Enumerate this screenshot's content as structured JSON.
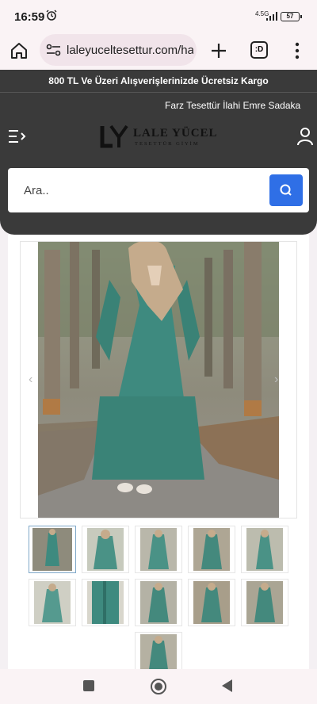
{
  "status": {
    "time": "16:59",
    "network": "4.5G",
    "battery": "57"
  },
  "browser": {
    "url": "laleyuceltesettur.com/haf",
    "tabs_label": ":D"
  },
  "promo": {
    "text": "800 TL Ve Üzeri Alışverişlerinizde Ücretsiz Kargo"
  },
  "ticker": {
    "text": "Farz Tesettür İlahi Emre Sadaka"
  },
  "brand": {
    "name": "LALE YÜCEL",
    "tagline": "TESETTÜR GİYİM",
    "mark": "LY"
  },
  "search": {
    "placeholder": "Ara.."
  },
  "product": {
    "thumbnail_count": 11,
    "active_thumbnail": 1
  },
  "colors": {
    "header_bg": "#3a3a3a",
    "accent": "#2f6fe6",
    "dress": "#3e8a7f"
  },
  "icons": [
    "alarm-icon",
    "home-icon",
    "site-settings-icon",
    "plus-icon",
    "kebab-menu-icon",
    "hamburger-icon",
    "user-icon",
    "search-icon",
    "chevron-left-icon",
    "chevron-right-icon"
  ]
}
